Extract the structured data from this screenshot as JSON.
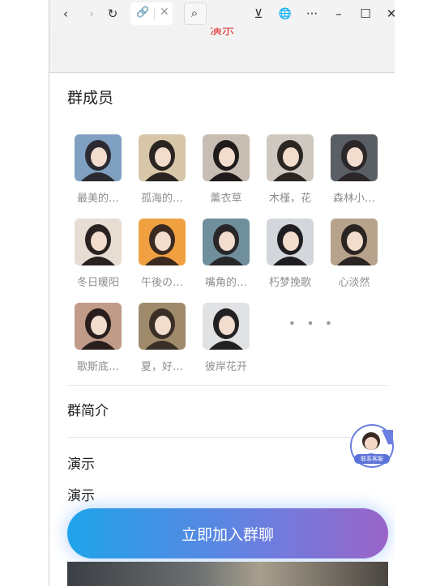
{
  "toolbar": {
    "back_icon": "‹",
    "forward_icon": "›",
    "reload_icon": "↻",
    "link_icon": "🔗",
    "close_tab_icon": "✕",
    "search_icon": "⌕",
    "download_icon": "⊻",
    "globe_icon": "🌐",
    "more_icon": "···",
    "minimize_icon": "–",
    "maximize_icon": "☐",
    "close_icon": "✕"
  },
  "header": {
    "title": "演示"
  },
  "members": {
    "title": "群成员",
    "items": [
      {
        "name": "最美的…",
        "colors": [
          "#7fa0c0",
          "#2b2a30"
        ]
      },
      {
        "name": "孤海的…",
        "colors": [
          "#d8c6a8",
          "#2a2520"
        ]
      },
      {
        "name": "薰衣草",
        "colors": [
          "#c7bdb3",
          "#1f1b1a"
        ]
      },
      {
        "name": "木槿，花",
        "colors": [
          "#cfc8c0",
          "#2c2622"
        ]
      },
      {
        "name": "森林小…",
        "colors": [
          "#5a5f66",
          "#2b2628"
        ]
      },
      {
        "name": "冬日暖阳",
        "colors": [
          "#e8ddd2",
          "#2a2221"
        ]
      },
      {
        "name": "午後の…",
        "colors": [
          "#f0a040",
          "#3b2a20"
        ]
      },
      {
        "name": "嘴角的…",
        "colors": [
          "#6f8f9c",
          "#282628"
        ]
      },
      {
        "name": "朽梦挽歌",
        "colors": [
          "#d3d7dc",
          "#1f1d22"
        ]
      },
      {
        "name": "心淡然",
        "colors": [
          "#b7a28c",
          "#2a2423"
        ]
      },
      {
        "name": "歌斯底…",
        "colors": [
          "#c09b88",
          "#2a1e1d"
        ]
      },
      {
        "name": "夏，好…",
        "colors": [
          "#a08a6c",
          "#3a2f27"
        ]
      },
      {
        "name": "彼岸花开",
        "colors": [
          "#e0e2e3",
          "#222022"
        ]
      }
    ],
    "more": "• • •"
  },
  "intro": {
    "title": "群简介"
  },
  "notice": {
    "line1": "演示",
    "line2": "演示"
  },
  "customer_service": {
    "label": "联系客服"
  },
  "join_button": {
    "label": "立即加入群聊"
  }
}
